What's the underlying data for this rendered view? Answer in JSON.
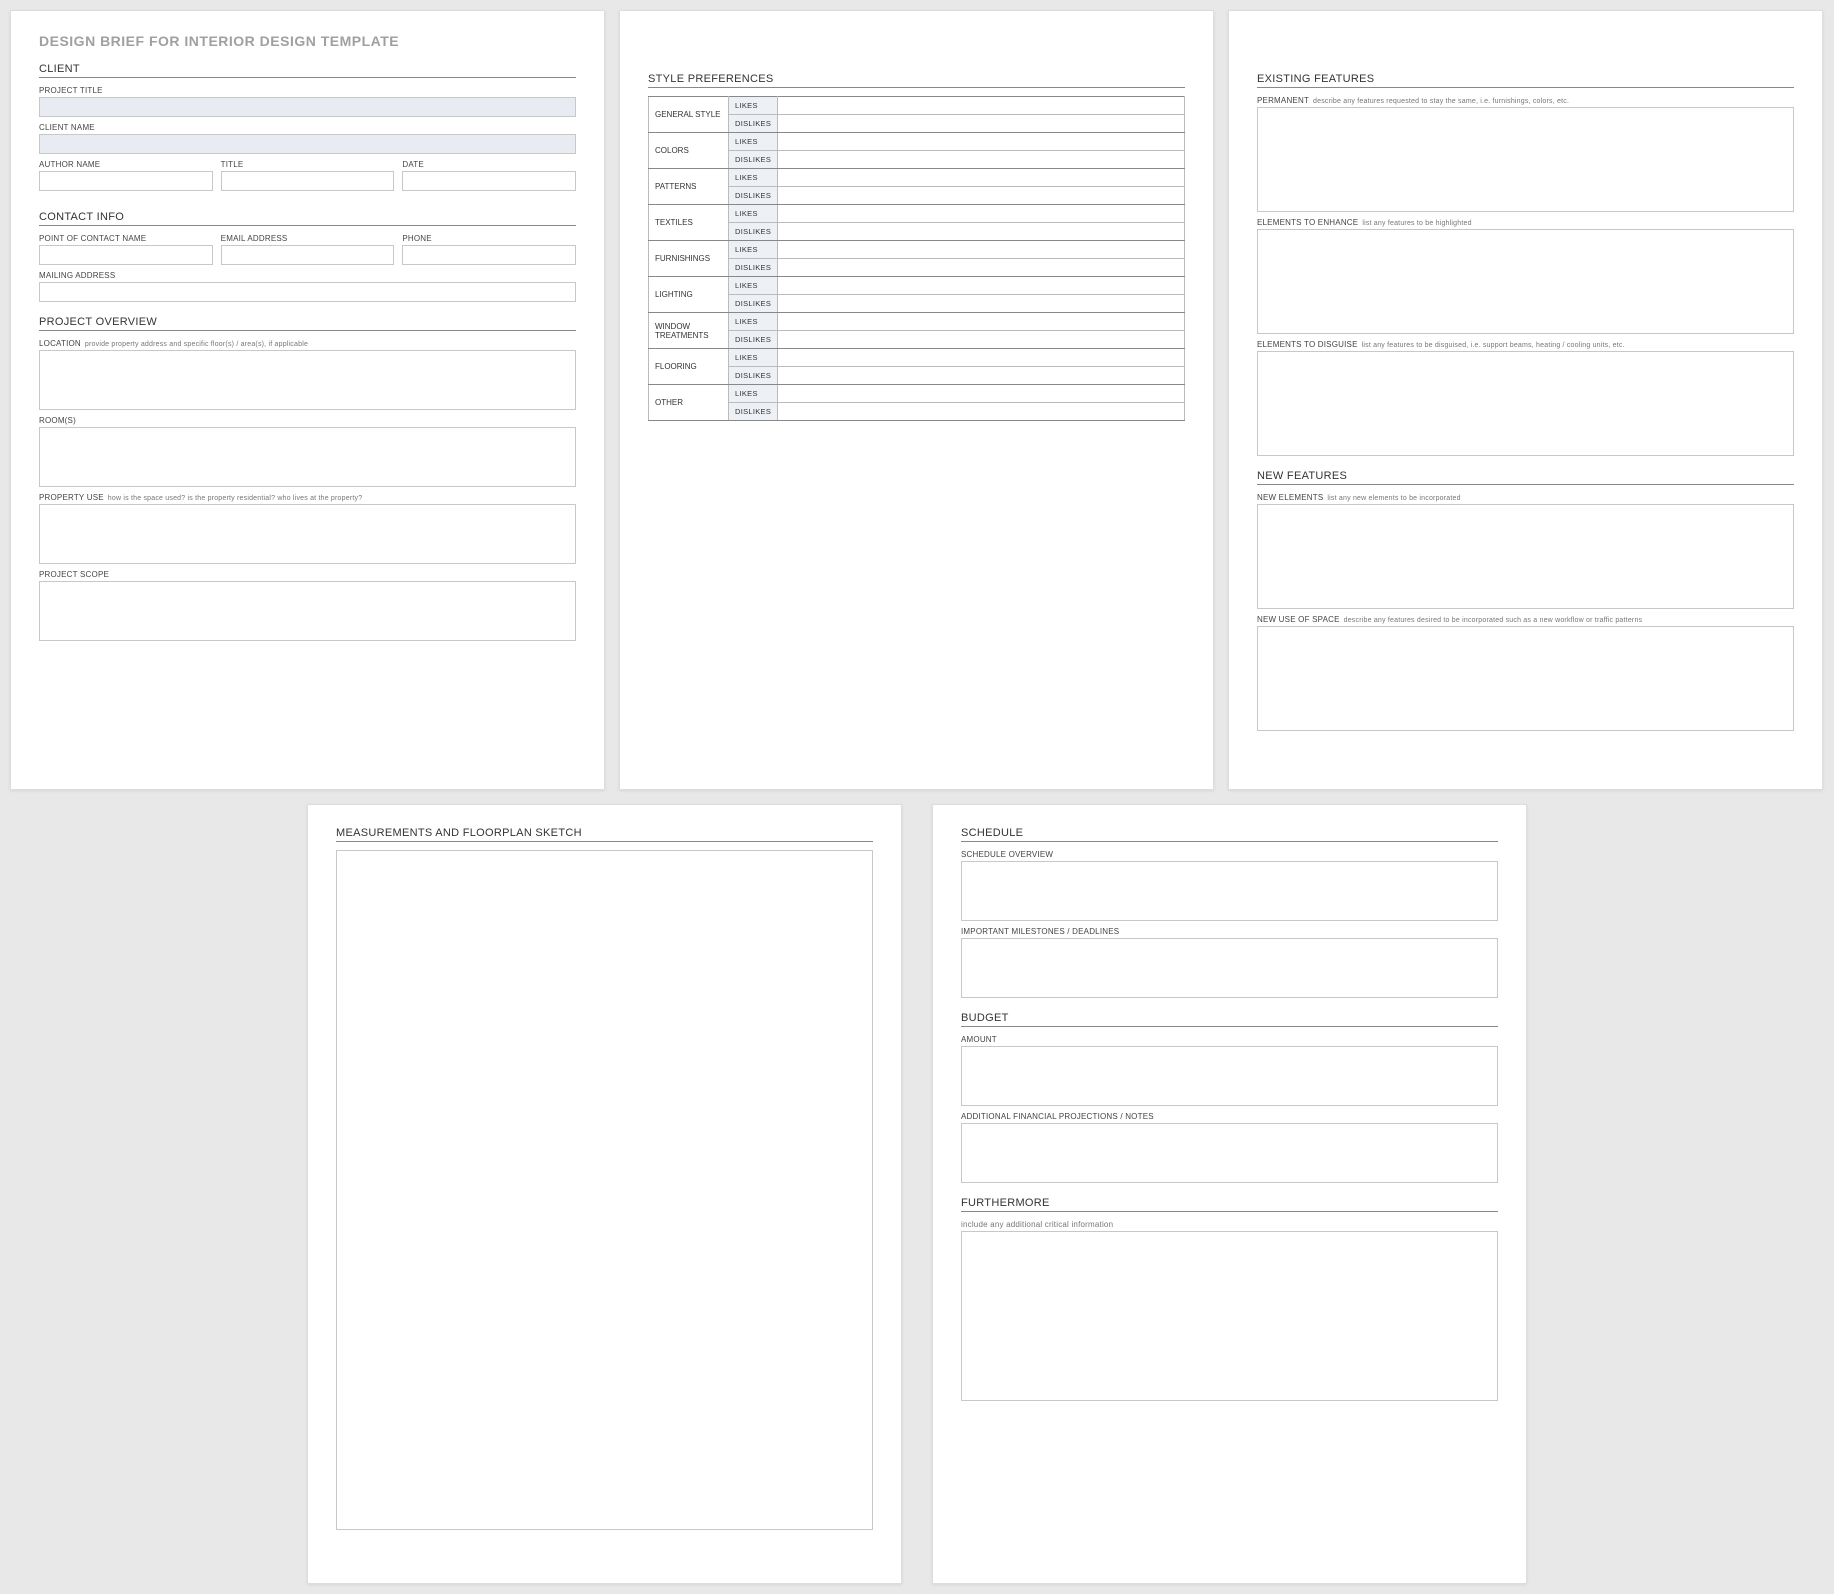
{
  "main_title": "DESIGN BRIEF FOR INTERIOR DESIGN TEMPLATE",
  "client": {
    "heading": "CLIENT",
    "project_title_label": "PROJECT TITLE",
    "client_name_label": "CLIENT NAME",
    "author_name_label": "AUTHOR NAME",
    "title_label": "TITLE",
    "date_label": "DATE"
  },
  "contact": {
    "heading": "CONTACT INFO",
    "poc_label": "POINT OF CONTACT NAME",
    "email_label": "EMAIL ADDRESS",
    "phone_label": "PHONE",
    "mailing_label": "MAILING ADDRESS"
  },
  "overview": {
    "heading": "PROJECT OVERVIEW",
    "location_label": "LOCATION",
    "location_hint": "provide property address and specific floor(s) / area(s), if applicable",
    "rooms_label": "ROOM(S)",
    "use_label": "PROPERTY USE",
    "use_hint": "how is the space used?  is the property residential? who lives at the property?",
    "scope_label": "PROJECT SCOPE"
  },
  "style": {
    "heading": "STYLE PREFERENCES",
    "likes": "LIKES",
    "dislikes": "DISLIKES",
    "categories": {
      "general": "GENERAL STYLE",
      "colors": "COLORS",
      "patterns": "PATTERNS",
      "textiles": "TEXTILES",
      "furnishings": "FURNISHINGS",
      "lighting": "LIGHTING",
      "window": "WINDOW TREATMENTS",
      "flooring": "FLOORING",
      "other": "OTHER"
    }
  },
  "existing": {
    "heading": "EXISTING FEATURES",
    "permanent_label": "PERMANENT",
    "permanent_hint": "describe any features requested to stay the same, i.e. furnishings, colors, etc.",
    "enhance_label": "ELEMENTS TO ENHANCE",
    "enhance_hint": "list any features to be highlighted",
    "disguise_label": "ELEMENTS TO DISGUISE",
    "disguise_hint": "list any features to be disguised, i.e. support beams, heating / cooling units, etc."
  },
  "newfeat": {
    "heading": "NEW FEATURES",
    "elements_label": "NEW ELEMENTS",
    "elements_hint": "list any new elements to be incorporated",
    "use_label": "NEW USE OF SPACE",
    "use_hint": "describe any features desired to be incorporated such as a new workflow or traffic patterns"
  },
  "sketch": {
    "heading": "MEASUREMENTS AND FLOORPLAN SKETCH"
  },
  "schedule": {
    "heading": "SCHEDULE",
    "overview_label": "SCHEDULE OVERVIEW",
    "milestones_label": "IMPORTANT MILESTONES / DEADLINES"
  },
  "budget": {
    "heading": "BUDGET",
    "amount_label": "AMOUNT",
    "notes_label": "ADDITIONAL FINANCIAL PROJECTIONS / NOTES"
  },
  "furthermore": {
    "heading": "FURTHERMORE",
    "hint": "include any additional critical information"
  }
}
